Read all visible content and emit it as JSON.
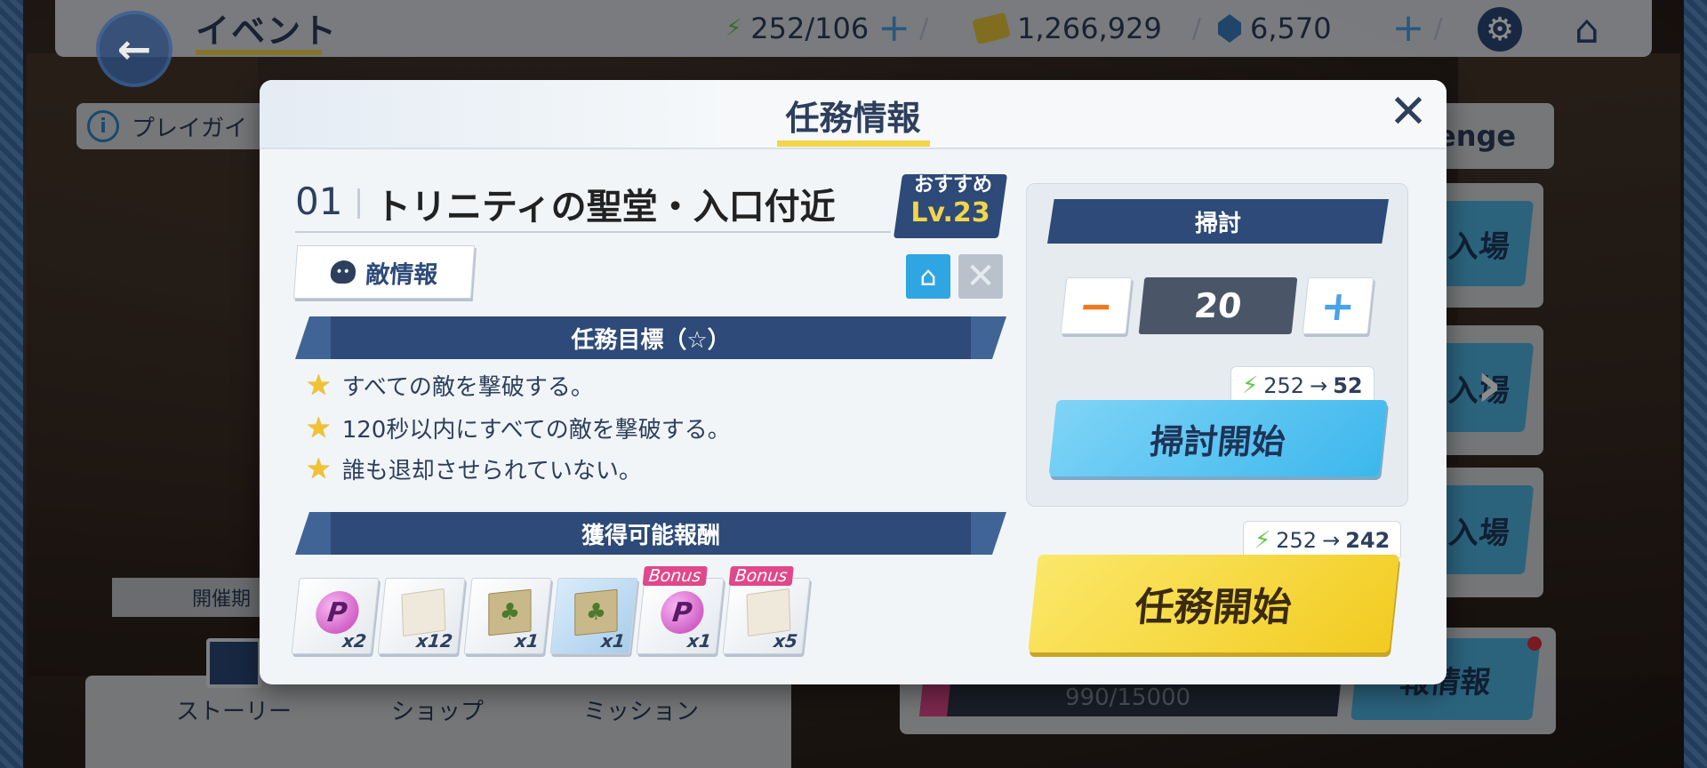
{
  "header": {
    "page_title": "イベント",
    "back_icon": "back-arrow-icon",
    "resources": [
      {
        "icon": "ap-bolt-icon",
        "value": "252/106",
        "has_add": true
      },
      {
        "icon": "credit-card-icon",
        "value": "1,266,929",
        "has_add": false
      },
      {
        "icon": "pyroxene-gem-icon",
        "value": "6,570",
        "has_add": true
      }
    ],
    "settings_icon": "gear-icon",
    "home_icon": "home-icon"
  },
  "background": {
    "guide_label": "プレイガイ",
    "challenge_tab": "enge",
    "enter_label": "入場",
    "period_label": "開催期",
    "progress_text": "990/15000",
    "info_button": "報情報",
    "bottom_nav": [
      "ストーリー",
      "ショップ",
      "ミッション"
    ]
  },
  "modal": {
    "title": "任務情報",
    "stage": {
      "number": "01",
      "name": "トリニティの聖堂・入口付近",
      "recommend_label": "おすすめ",
      "recommend_level": "Lv.23"
    },
    "enemy_info_label": "敵情報",
    "objectives_header": "任務目標（☆）",
    "objectives": [
      "すべての敵を撃破する。",
      "120秒以内にすべての敵を撃破する。",
      "誰も退却させられていない。"
    ],
    "rewards_header": "獲得可能報酬",
    "rewards": [
      {
        "icon": "p-coin-icon",
        "qty": "x2",
        "bonus": false
      },
      {
        "icon": "blueprint-paper-icon",
        "qty": "x12",
        "bonus": false
      },
      {
        "icon": "map-scroll-icon",
        "qty": "x1",
        "bonus": false
      },
      {
        "icon": "map-scroll-icon",
        "qty": "x1",
        "bonus": false
      },
      {
        "icon": "p-coin-icon",
        "qty": "x1",
        "bonus": true
      },
      {
        "icon": "blueprint-paper-icon",
        "qty": "x5",
        "bonus": true
      }
    ],
    "bonus_label": "Bonus",
    "sweep": {
      "header": "掃討",
      "count": "20",
      "ap_from": "252",
      "ap_to": "52",
      "button_label": "掃討開始"
    },
    "start": {
      "ap_from": "252",
      "ap_to": "242",
      "button_label": "任務開始"
    }
  },
  "colors": {
    "navy": "#2d4a78",
    "accent_yellow": "#f3d54a",
    "sky_blue": "#4fb4e4",
    "bonus_pink": "#e0488a",
    "ap_green": "#62c84a"
  }
}
